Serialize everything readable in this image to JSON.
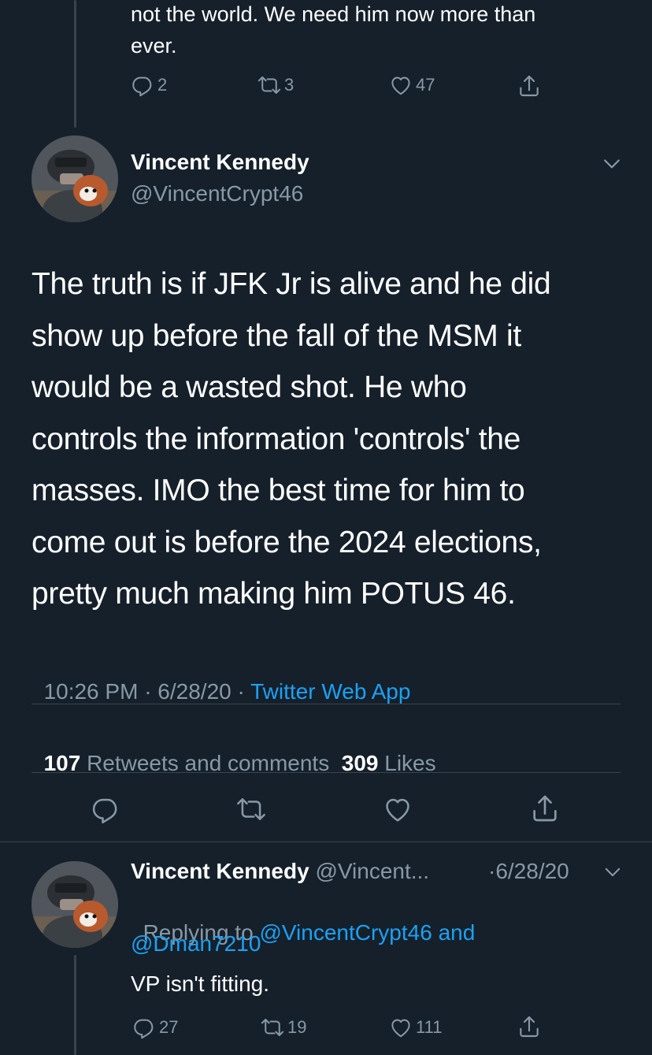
{
  "prev_tweet": {
    "text_line1": "not the world. We need him now more than",
    "text_line2": "ever.",
    "replies": "2",
    "retweets": "3",
    "likes": "47"
  },
  "main_tweet": {
    "display_name": "Vincent Kennedy",
    "handle": "@VincentCrypt46",
    "lines": [
      "The truth is if JFK Jr is alive and he did",
      "show up before the fall of the MSM it",
      "would be a wasted shot. He who",
      "controls the information 'controls' the",
      "masses. IMO the best time for him to",
      "come out is before the 2024 elections,",
      "pretty much making him POTUS 46."
    ],
    "time": "10:26 PM · 6/28/20 · ",
    "source": "Twitter Web App",
    "retweets_count": "107",
    "retweets_label": "Retweets and comments",
    "likes_count": "309",
    "likes_label": "Likes"
  },
  "reply_tweet": {
    "display_name": "Vincent Kennedy",
    "handle": "@Vincent...",
    "date": "·6/28/20",
    "replying_prefix": "Replying to",
    "replying_handle1": "@VincentCrypt46",
    "replying_and": "and",
    "replying_handle2": "@Dman7210",
    "text": "VP isn't fitting.",
    "replies": "27",
    "retweets": "19",
    "likes": "111"
  },
  "colors": {
    "background": "#15202b",
    "muted": "#8899a6",
    "link": "#1da1f2",
    "divider": "#38444d"
  },
  "icons": [
    "reply-icon",
    "retweet-icon",
    "like-icon",
    "share-icon",
    "chevron-down-icon"
  ]
}
